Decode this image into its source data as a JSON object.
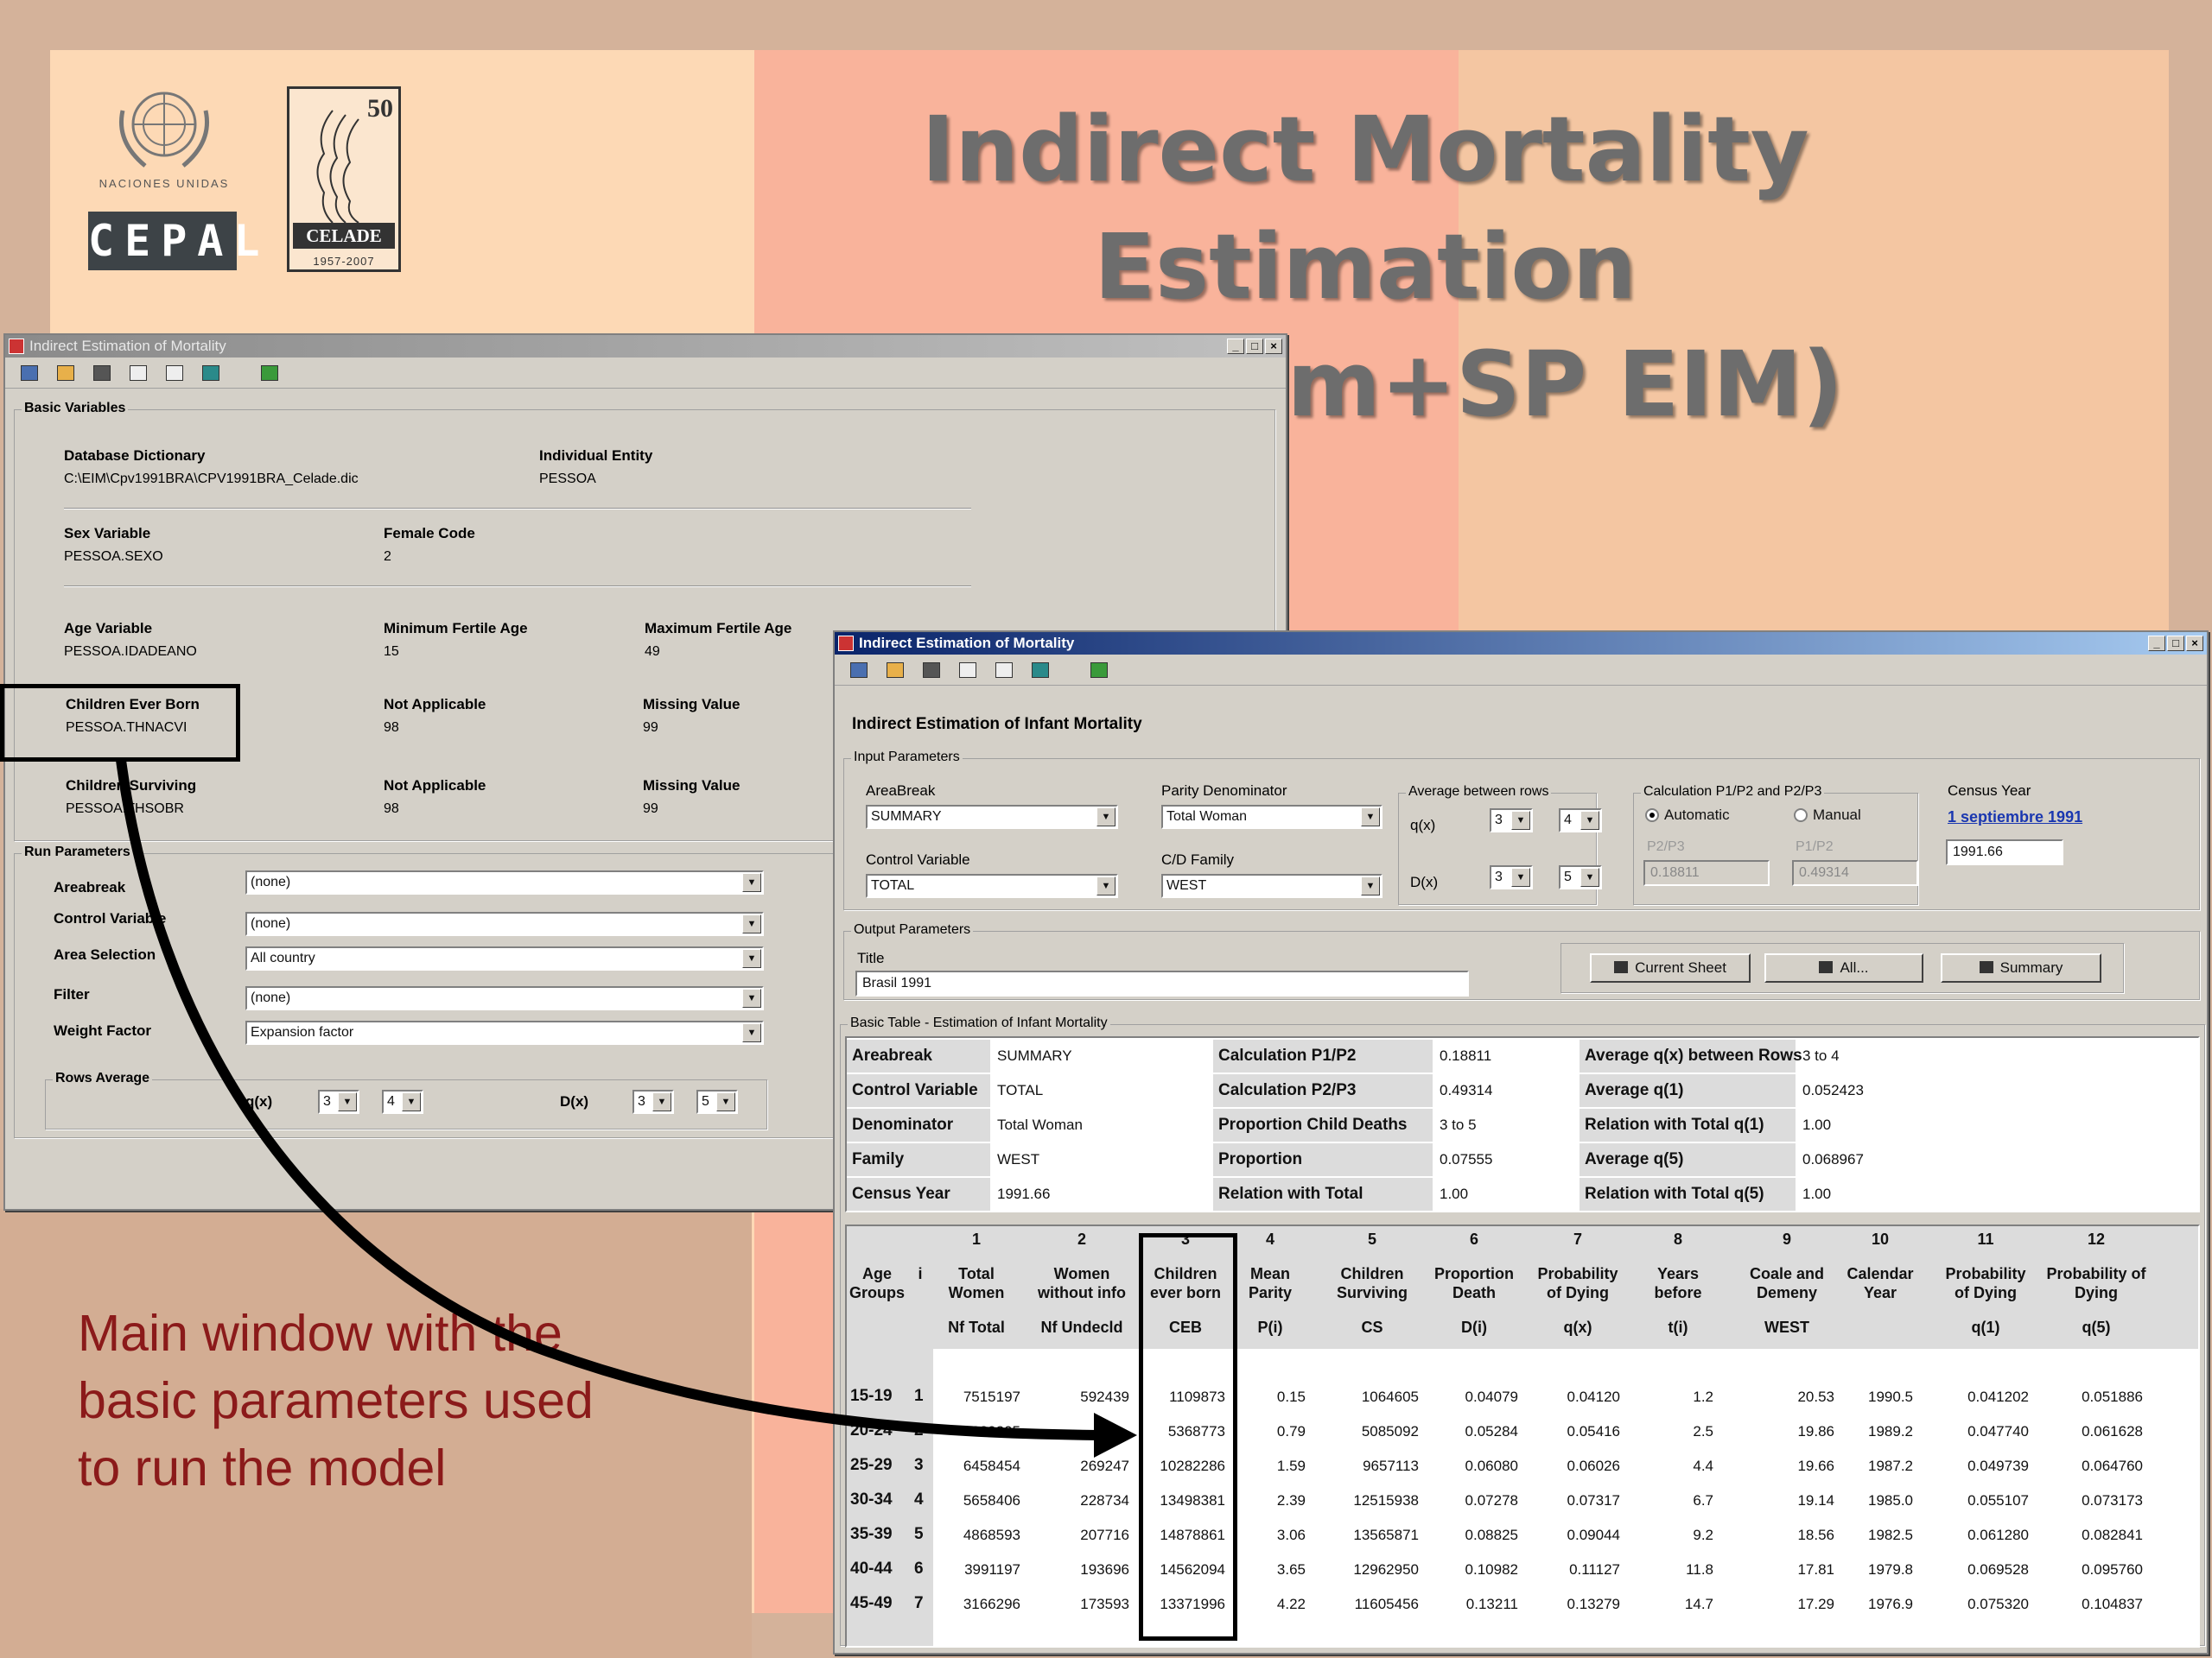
{
  "slide": {
    "title_line1": "Indirect Mortality Estimation",
    "title_line2": "(Redatam+SP EIM)",
    "un_text": "NACIONES UNIDAS",
    "cepal_text": "CEPAL",
    "celade_fifty": "50",
    "celade_name": "CELADE",
    "celade_years": "1957-2007",
    "caption_line1": "Main window with the",
    "caption_line2": "basic parameters used",
    "caption_line3": "to run the model"
  },
  "main_window": {
    "title": "Indirect Estimation of Mortality",
    "group_basic": "Basic Variables",
    "db_dict_label": "Database Dictionary",
    "db_dict_value": "C:\\EIM\\Cpv1991BRA\\CPV1991BRA_Celade.dic",
    "indiv_entity_label": "Individual Entity",
    "indiv_entity_value": "PESSOA",
    "sex_var_label": "Sex Variable",
    "sex_var_value": "PESSOA.SEXO",
    "female_code_label": "Female Code",
    "female_code_value": "2",
    "age_var_label": "Age Variable",
    "age_var_value": "PESSOA.IDADEANO",
    "min_fert_label": "Minimum Fertile Age",
    "min_fert_value": "15",
    "max_fert_label": "Maximum Fertile Age",
    "max_fert_value": "49",
    "ceb_label": "Children Ever Born",
    "ceb_value": "PESSOA.THNACVI",
    "na1_label": "Not Applicable",
    "na1_value": "98",
    "mv1_label": "Missing Value",
    "mv1_value": "99",
    "cs_label": "Children Surviving",
    "cs_value": "PESSOA.THSOBR",
    "na2_label": "Not Applicable",
    "na2_value": "98",
    "mv2_label": "Missing Value",
    "mv2_value": "99",
    "group_run": "Run Parameters",
    "areabreak_label": "Areabreak",
    "areabreak_value": "(none)",
    "control_label": "Control Variable",
    "control_value": "(none)",
    "area_sel_label": "Area Selection",
    "area_sel_value": "All country",
    "filter_label": "Filter",
    "filter_value": "(none)",
    "weight_label": "Weight Factor",
    "weight_value": "Expansion factor",
    "rows_avg_label": "Rows Average",
    "qx_label": "q(x)",
    "qx_from": "3",
    "qx_to": "4",
    "dx_label": "D(x)",
    "dx_from": "3",
    "dx_to": "5"
  },
  "second_window": {
    "title": "Indirect Estimation of Mortality",
    "heading": "Indirect Estimation of Infant Mortality",
    "group_input": "Input Parameters",
    "areabreak_label": "AreaBreak",
    "areabreak_value": "SUMMARY",
    "parity_label": "Parity Denominator",
    "parity_value": "Total Woman",
    "control_label": "Control Variable",
    "control_value": "TOTAL",
    "cd_family_label": "C/D Family",
    "cd_family_value": "WEST",
    "avg_rows_label": "Average between rows",
    "qx_label": "q(x)",
    "qx_from": "3",
    "qx_to": "4",
    "dx_label": "D(x)",
    "dx_from": "3",
    "dx_to": "5",
    "calc_label": "Calculation P1/P2 and P2/P3",
    "radio_auto": "Automatic",
    "radio_manual": "Manual",
    "p2p3_label": "P2/P3",
    "p2p3_value": "0.18811",
    "p1p2_label": "P1/P2",
    "p1p2_value": "0.49314",
    "census_year_label": "Census Year",
    "census_year_link": "1 septiembre 1991",
    "census_year_value": "1991.66",
    "group_output": "Output Parameters",
    "title_label": "Title",
    "title_value": "Brasil 1991",
    "btn_current": "Current Sheet",
    "btn_all": "All...",
    "btn_summary": "Summary",
    "group_basic_table": "Basic Table - Estimation of Infant Mortality",
    "summary": [
      [
        "Areabreak",
        "SUMMARY",
        "Calculation P1/P2",
        "0.18811",
        "Average q(x) between Rows",
        "3 to 4"
      ],
      [
        "Control Variable",
        "TOTAL",
        "Calculation P2/P3",
        "0.49314",
        "Average q(1)",
        "0.052423"
      ],
      [
        "Denominator",
        "Total Woman",
        "Proportion Child Deaths",
        "3 to 5",
        "Relation with Total q(1)",
        "1.00"
      ],
      [
        "Family",
        "WEST",
        "Proportion",
        "0.07555",
        "Average q(5)",
        "0.068967"
      ],
      [
        "Census Year",
        "1991.66",
        "Relation with Total",
        "1.00",
        "Relation with Total q(5)",
        "1.00"
      ]
    ],
    "table": {
      "header_age": "Age Groups",
      "header_i": "i",
      "columns": [
        {
          "num": "1",
          "name": "Total Women",
          "code": "Nf Total"
        },
        {
          "num": "2",
          "name": "Women without info",
          "code": "Nf Undecld"
        },
        {
          "num": "3",
          "name": "Children ever born",
          "code": "CEB"
        },
        {
          "num": "4",
          "name": "Mean Parity",
          "code": "P(i)"
        },
        {
          "num": "5",
          "name": "Children Surviving",
          "code": "CS"
        },
        {
          "num": "6",
          "name": "Proportion Death",
          "code": "D(i)"
        },
        {
          "num": "7",
          "name": "Probability of Dying",
          "code": "q(x)"
        },
        {
          "num": "8",
          "name": "Years before",
          "code": "t(i)"
        },
        {
          "num": "9",
          "name": "Coale and Demeny",
          "code": "WEST"
        },
        {
          "num": "10",
          "name": "Calendar Year",
          "code": ""
        },
        {
          "num": "11",
          "name": "Probability of Dying",
          "code": "q(1)"
        },
        {
          "num": "12",
          "name": "Probability of Dying",
          "code": "q(5)"
        }
      ],
      "rows": [
        {
          "age": "15-19",
          "i": "1",
          "cells": [
            "7515197",
            "592439",
            "1109873",
            "0.15",
            "1064605",
            "0.04079",
            "0.04120",
            "1.2",
            "20.53",
            "1990.5",
            "0.041202",
            "0.051886"
          ]
        },
        {
          "age": "20-24",
          "i": "2",
          "cells": [
            "6830205",
            "",
            "5368773",
            "0.79",
            "5085092",
            "0.05284",
            "0.05416",
            "2.5",
            "19.86",
            "1989.2",
            "0.047740",
            "0.061628"
          ]
        },
        {
          "age": "25-29",
          "i": "3",
          "cells": [
            "6458454",
            "269247",
            "10282286",
            "1.59",
            "9657113",
            "0.06080",
            "0.06026",
            "4.4",
            "19.66",
            "1987.2",
            "0.049739",
            "0.064760"
          ]
        },
        {
          "age": "30-34",
          "i": "4",
          "cells": [
            "5658406",
            "228734",
            "13498381",
            "2.39",
            "12515938",
            "0.07278",
            "0.07317",
            "6.7",
            "19.14",
            "1985.0",
            "0.055107",
            "0.073173"
          ]
        },
        {
          "age": "35-39",
          "i": "5",
          "cells": [
            "4868593",
            "207716",
            "14878861",
            "3.06",
            "13565871",
            "0.08825",
            "0.09044",
            "9.2",
            "18.56",
            "1982.5",
            "0.061280",
            "0.082841"
          ]
        },
        {
          "age": "40-44",
          "i": "6",
          "cells": [
            "3991197",
            "193696",
            "14562094",
            "3.65",
            "12962950",
            "0.10982",
            "0.11127",
            "11.8",
            "17.81",
            "1979.8",
            "0.069528",
            "0.095760"
          ]
        },
        {
          "age": "45-49",
          "i": "7",
          "cells": [
            "3166296",
            "173593",
            "13371996",
            "4.22",
            "11605456",
            "0.13211",
            "0.13279",
            "14.7",
            "17.29",
            "1976.9",
            "0.075320",
            "0.104837"
          ]
        }
      ]
    }
  }
}
